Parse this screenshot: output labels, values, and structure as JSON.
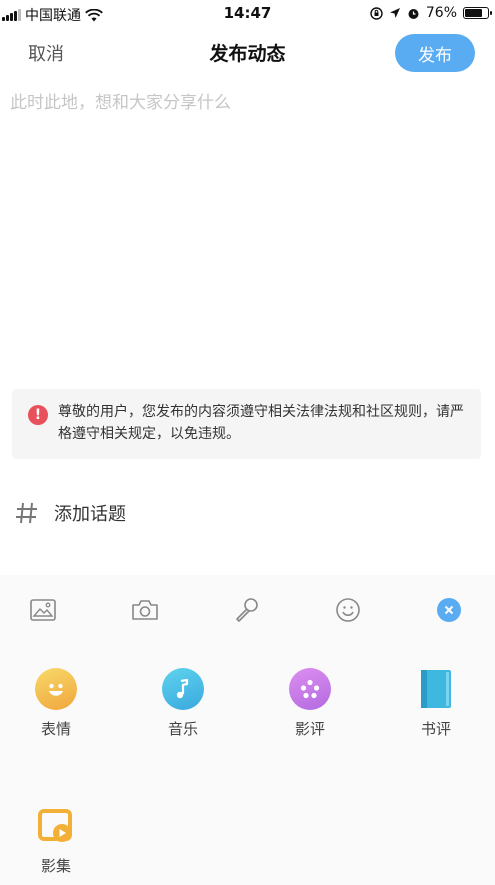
{
  "status_bar": {
    "carrier": "中国联通",
    "time": "14:47",
    "battery_percent_label": "76%",
    "battery_level": 0.76
  },
  "nav": {
    "cancel_label": "取消",
    "title": "发布动态",
    "publish_label": "发布",
    "publish_color": "#5aacf2"
  },
  "composer": {
    "placeholder": "此时此地，想和大家分享什么",
    "value": ""
  },
  "notice": {
    "icon": "warning-icon",
    "text": "尊敬的用户，您发布的内容须遵守相关法律法规和社区规则，请严格遵守相关规定，以免违规。",
    "accent_color": "#e8505b"
  },
  "topic": {
    "icon": "hash-icon",
    "label": "添加话题"
  },
  "toolbar": {
    "items": [
      "image-icon",
      "camera-icon",
      "microphone-icon",
      "emoji-icon",
      "close-icon"
    ]
  },
  "panel": {
    "items": [
      {
        "label": "表情",
        "icon": "emoji-icon",
        "color": "#f2b84b"
      },
      {
        "label": "音乐",
        "icon": "music-icon",
        "color": "#46c0e6"
      },
      {
        "label": "影评",
        "icon": "film-reel-icon",
        "color": "#c97de6"
      },
      {
        "label": "书评",
        "icon": "book-icon",
        "color": "#3fb8e0"
      },
      {
        "label": "影集",
        "icon": "video-album-icon",
        "color": "#f2b136"
      }
    ]
  }
}
